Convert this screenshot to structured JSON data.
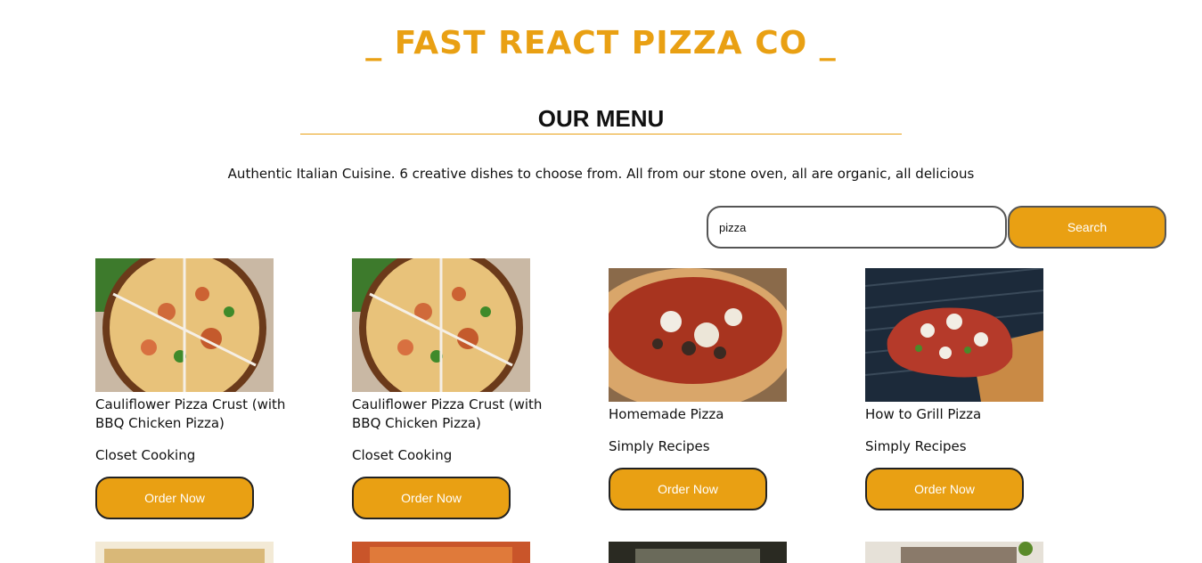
{
  "header": {
    "brand": "_ FAST REACT PIZZA CO _"
  },
  "menu": {
    "title": "OUR MENU",
    "tagline": "Authentic Italian Cuisine. 6 creative dishes to choose from. All from our stone oven, all are organic, all delicious"
  },
  "search": {
    "value": "pizza",
    "button_label": "Search"
  },
  "recipes": [
    {
      "title": "Cauliflower Pizza Crust (with BBQ Chicken Pizza)",
      "publisher": "Closet Cooking",
      "button": "Order Now"
    },
    {
      "title": "Cauliflower Pizza Crust (with BBQ Chicken Pizza)",
      "publisher": "Closet Cooking",
      "button": "Order Now"
    },
    {
      "title": "Homemade Pizza",
      "publisher": "Simply Recipes",
      "button": "Order Now"
    },
    {
      "title": "How to Grill Pizza",
      "publisher": "Simply Recipes",
      "button": "Order Now"
    }
  ],
  "colors": {
    "accent": "#e9a013",
    "text": "#111111"
  }
}
